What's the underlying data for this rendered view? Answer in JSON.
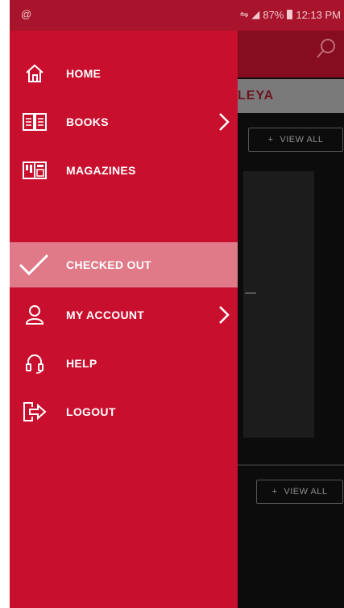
{
  "status_bar": {
    "left_icon": "@",
    "signal": "⇋ ◢",
    "battery": "87%",
    "time": "12:13 PM"
  },
  "background": {
    "banner_text": "LEYA",
    "view_all_1": "VIEW ALL",
    "view_all_2": "VIEW ALL",
    "plus": "+"
  },
  "drawer": {
    "items": [
      {
        "label": "HOME",
        "icon": "home-icon"
      },
      {
        "label": "BOOKS",
        "icon": "books-icon",
        "has_submenu": true
      },
      {
        "label": "MAGAZINES",
        "icon": "magazines-icon"
      },
      {
        "label": "CHECKED OUT",
        "icon": "checkmark-icon",
        "active": true
      },
      {
        "label": "MY ACCOUNT",
        "icon": "user-icon",
        "has_submenu": true
      },
      {
        "label": "HELP",
        "icon": "headphones-icon"
      },
      {
        "label": "LOGOUT",
        "icon": "logout-icon"
      }
    ]
  },
  "colors": {
    "drawer_bg": "#c8102e",
    "active_bg": "#e07a89",
    "statusbar_bg": "#a7142b",
    "appbar_bg": "#860d20"
  }
}
